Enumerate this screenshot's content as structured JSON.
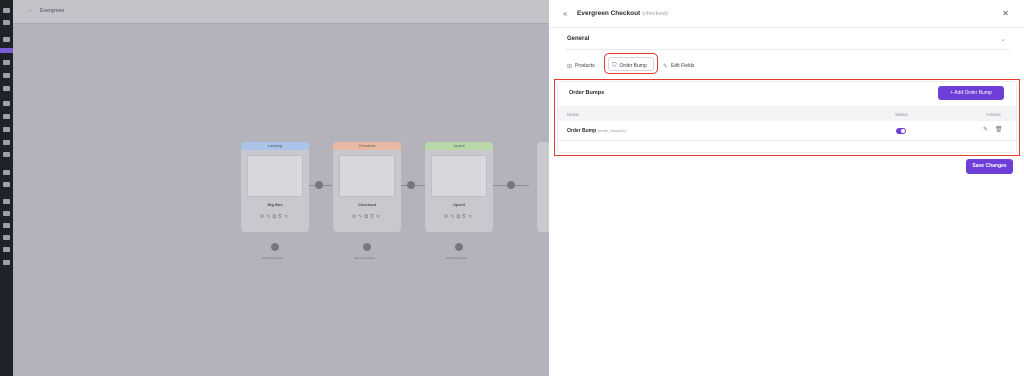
{
  "canvas": {
    "title": "Evergreen",
    "steps": [
      {
        "header": "Landing",
        "name": "Big Bus",
        "color": "#a9c4e8"
      },
      {
        "header": "Checkout",
        "name": "Checkout",
        "color": "#e9b9a4"
      },
      {
        "header": "Upsell",
        "name": "Upsell",
        "color": "#b9d9a9"
      }
    ],
    "nodes": [
      "Add Automation",
      "Add Automation",
      "Add Automation"
    ]
  },
  "panel": {
    "collapse_icon": "double-chevron-left-icon",
    "title": "Evergreen Checkout",
    "subtitle": "(checkout)",
    "close_icon": "close-icon",
    "section": "General",
    "tabs": [
      {
        "label": "Products",
        "icon": "grid-icon"
      },
      {
        "label": "Order Bump",
        "icon": "cart-icon",
        "active": true
      },
      {
        "label": "Edit Fields",
        "icon": "pencil-icon"
      }
    ],
    "order_bumps": {
      "title": "Order Bumps",
      "add_label": "+ Add Order Bump",
      "columns": {
        "name": "Name",
        "status": "Status",
        "actions": "Actions"
      },
      "rows": [
        {
          "name": "Order Bump",
          "slug": "(order_bump#1)",
          "status": true
        }
      ]
    },
    "save_label": "Save Changes"
  },
  "colors": {
    "accent": "#6e3ed8",
    "highlight": "#e03c31"
  }
}
